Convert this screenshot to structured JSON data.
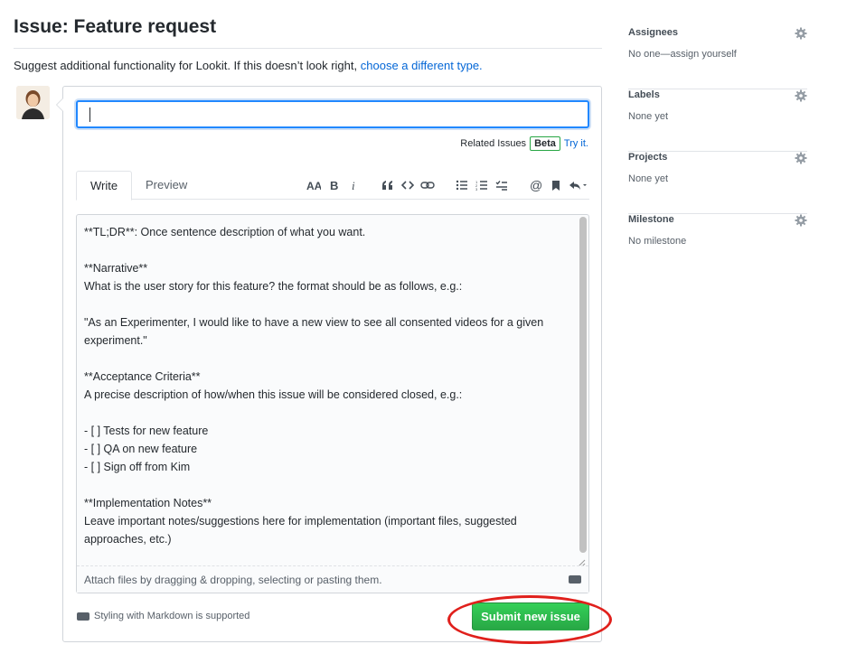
{
  "header": {
    "title": "Issue: Feature request",
    "subtitle_prefix": "Suggest additional functionality for Lookit. If this doesn’t look right,",
    "subtitle_link": "choose a different type."
  },
  "form": {
    "title_value": "",
    "related_label": "Related Issues",
    "beta_badge": "Beta",
    "try_it": "Try it.",
    "tabs": [
      {
        "label": "Write",
        "active": true
      },
      {
        "label": "Preview",
        "active": false
      }
    ],
    "toolbar": [
      {
        "icon": "text-size-icon",
        "glyph": "AA"
      },
      {
        "icon": "bold-icon",
        "glyph": "B"
      },
      {
        "icon": "italic-icon",
        "glyph": "i"
      },
      {
        "icon": "quote-icon",
        "glyph": "❝"
      },
      {
        "icon": "code-icon",
        "glyph": "<>"
      },
      {
        "icon": "link-icon",
        "glyph": "🔗"
      },
      {
        "icon": "unordered-list-icon",
        "glyph": "☰"
      },
      {
        "icon": "ordered-list-icon",
        "glyph": "≣"
      },
      {
        "icon": "task-list-icon",
        "glyph": "☑"
      },
      {
        "icon": "mention-icon",
        "glyph": "@"
      },
      {
        "icon": "bookmark-icon",
        "glyph": "🔖"
      },
      {
        "icon": "reply-icon",
        "glyph": "↩"
      }
    ],
    "body_lines": [
      "**TL;DR**: Once sentence description of what you want.",
      "",
      "**Narrative**",
      "What is the user story for this feature? the format should be as follows, e.g.:",
      "",
      "\"As an Experimenter, I would like to have a new view to see all consented videos for a given experiment.\"",
      "",
      "**Acceptance Criteria**",
      "A precise description of how/when this issue will be considered closed, e.g.:",
      "",
      "- [ ] Tests for new feature",
      "- [ ] QA on new feature",
      "- [ ] Sign off from Kim",
      "",
      "**Implementation Notes**",
      "Leave important notes/suggestions here for implementation (important files, suggested approaches, etc.)"
    ],
    "attach_hint": "Attach files by dragging & dropping, selecting or pasting them.",
    "markdown_note": "Styling with Markdown is supported",
    "submit_label": "Submit new issue"
  },
  "sidebar": {
    "sections": [
      {
        "heading": "Assignees",
        "value": "No one—assign yourself"
      },
      {
        "heading": "Labels",
        "value": "None yet"
      },
      {
        "heading": "Projects",
        "value": "None yet"
      },
      {
        "heading": "Milestone",
        "value": "No milestone"
      }
    ]
  },
  "colors": {
    "accent_blue": "#0366d6",
    "submit_green": "#28a745",
    "highlight_red": "#e0201c"
  }
}
